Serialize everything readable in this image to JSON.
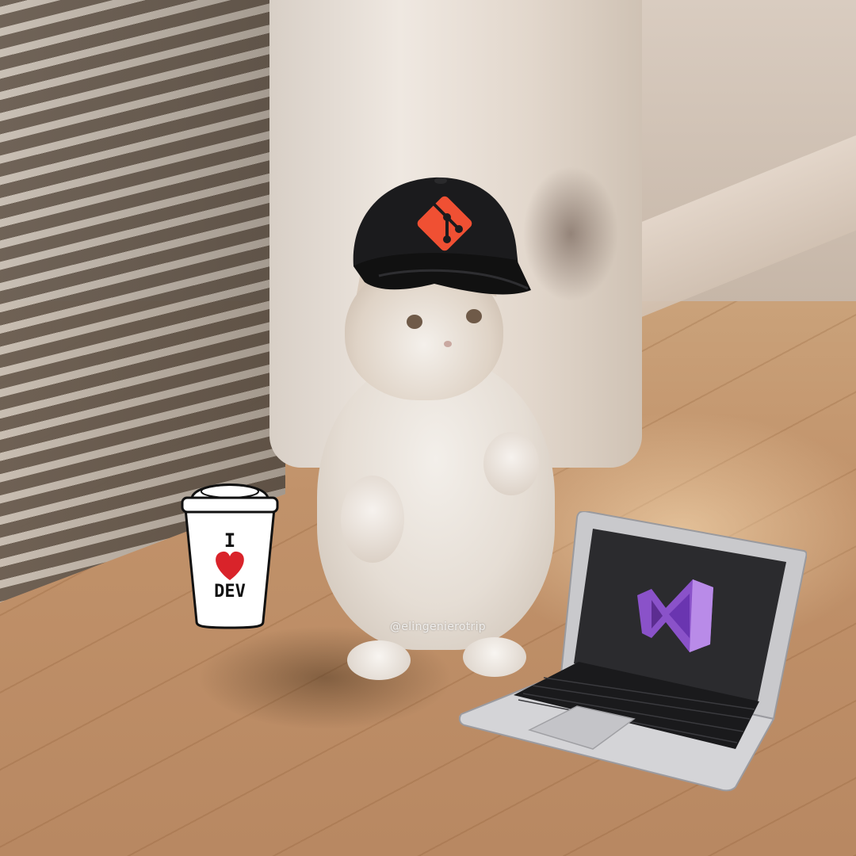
{
  "scene": {
    "description_tag": "photo",
    "subject": "cat",
    "props": [
      "git-cap",
      "coffee-cup",
      "laptop"
    ]
  },
  "cup": {
    "line1": "I",
    "line2": "DEV"
  },
  "watermark": {
    "text": "@elingenierotrip"
  },
  "colors": {
    "git_orange": "#f05033",
    "heart_red": "#d9232a",
    "vs_purple": "#8a52c9",
    "screen_dark": "#2b2b2e"
  }
}
